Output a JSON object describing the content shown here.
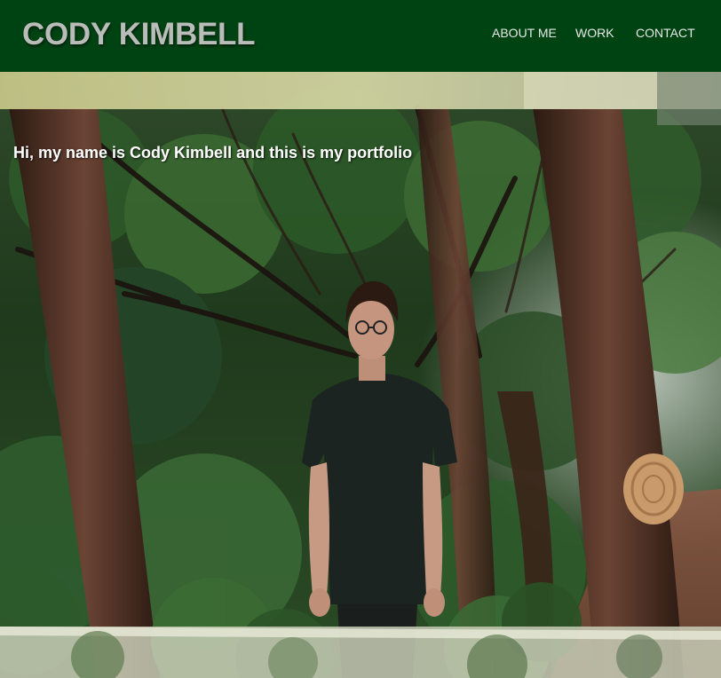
{
  "header": {
    "title": "CODY KIMBELL",
    "nav": [
      {
        "label": "ABOUT ME"
      },
      {
        "label": "WORK"
      },
      {
        "label": "CONTACT"
      }
    ],
    "background_color": "#004313"
  },
  "hero": {
    "greeting": "Hi, my name is Cody Kimbell and this is my portfolio",
    "image_description_icon": "forest-portrait-photo"
  }
}
